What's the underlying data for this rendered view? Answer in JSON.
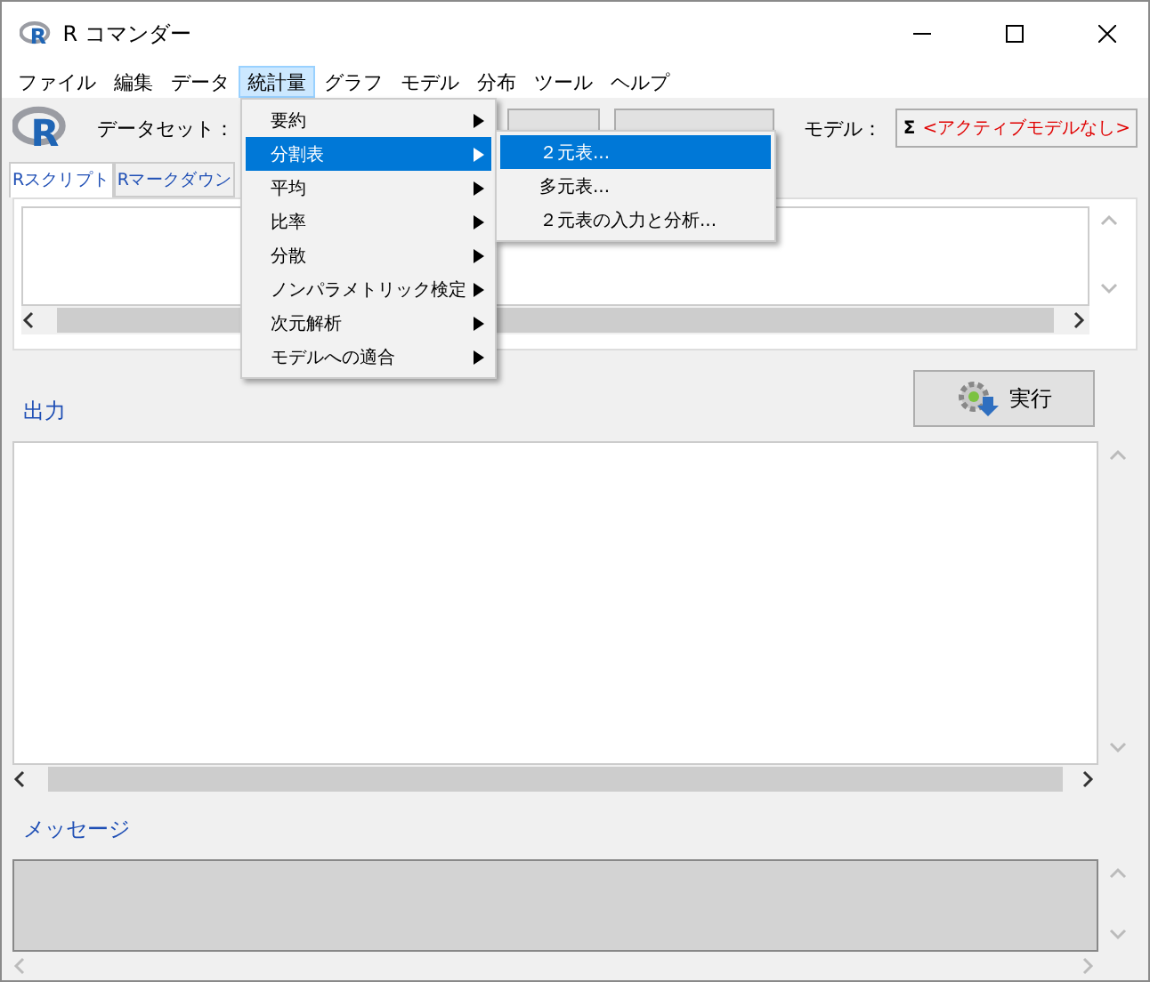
{
  "window": {
    "title": "R コマンダー",
    "icon_letter": "R"
  },
  "menu_bar": [
    {
      "label": "ファイル",
      "selected": false
    },
    {
      "label": "編集",
      "selected": false
    },
    {
      "label": "データ",
      "selected": false
    },
    {
      "label": "統計量",
      "selected": true
    },
    {
      "label": "グラフ",
      "selected": false
    },
    {
      "label": "モデル",
      "selected": false
    },
    {
      "label": "分布",
      "selected": false
    },
    {
      "label": "ツール",
      "selected": false
    },
    {
      "label": "ヘルプ",
      "selected": false
    }
  ],
  "toolbar": {
    "logo_letter": "R",
    "dataset_label": "データセット：",
    "model_label": "モデル：",
    "model_symbol": "Σ",
    "model_value": "<アクティブモデルなし>"
  },
  "tabs": [
    {
      "label": "Rスクリプト",
      "selected": true
    },
    {
      "label": "Rマークダウン",
      "selected": false
    }
  ],
  "execute_button": "実行",
  "output_label": "出力",
  "messages_label": "メッセージ",
  "menu": {
    "items": [
      {
        "label": "要約",
        "selected": false
      },
      {
        "label": "分割表",
        "selected": true
      },
      {
        "label": "平均",
        "selected": false
      },
      {
        "label": "比率",
        "selected": false
      },
      {
        "label": "分散",
        "selected": false
      },
      {
        "label": "ノンパラメトリック検定",
        "selected": false
      },
      {
        "label": "次元解析",
        "selected": false
      },
      {
        "label": "モデルへの適合",
        "selected": false
      }
    ],
    "submenu": [
      {
        "label": "２元表...",
        "selected": true
      },
      {
        "label": "多元表...",
        "selected": false
      },
      {
        "label": "２元表の入力と分析...",
        "selected": false
      }
    ]
  }
}
